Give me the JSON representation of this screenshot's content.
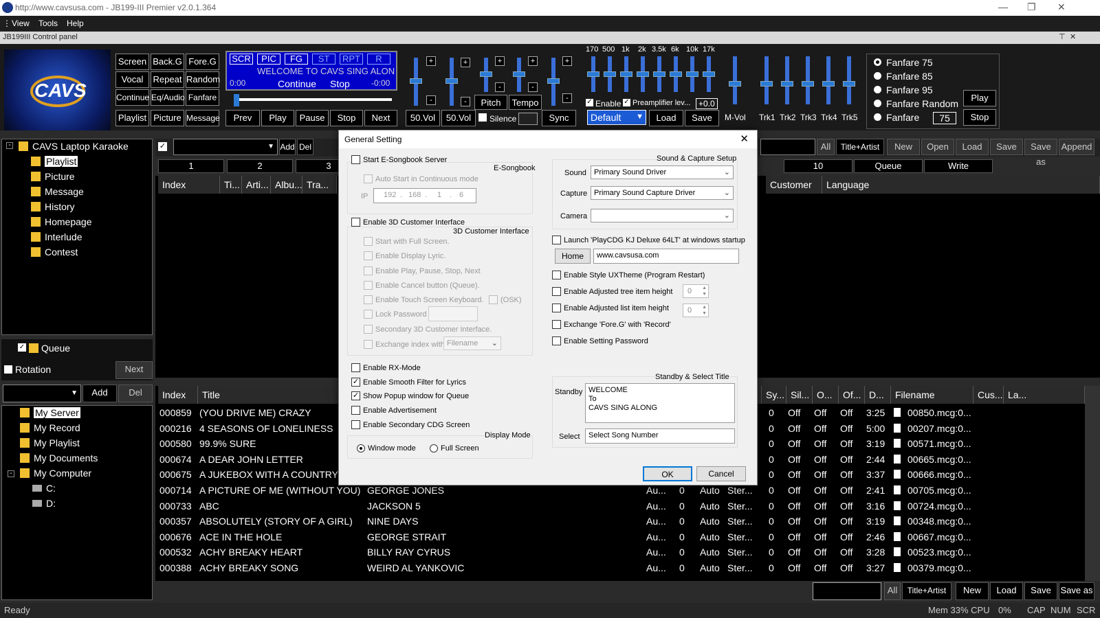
{
  "window": {
    "title": "http://www.cavsusa.com - JB199-III Premier v2.0.1.364"
  },
  "menu": [
    "View",
    "Tools",
    "Help"
  ],
  "control_panel_title": "JB199III Control panel",
  "logo_text": "CAVS",
  "control_buttons": [
    "Screen",
    "Back.G",
    "Fore.G",
    "Vocal",
    "Repeat",
    "Random",
    "Continue",
    "Eq/Audio",
    "Fanfare",
    "Playlist",
    "Picture",
    "Message"
  ],
  "screen": {
    "tags": [
      "SCR",
      "PIC",
      "FG",
      "ST",
      "RPT",
      "R"
    ],
    "marquee": "WELCOME TO CAVS SING ALON",
    "time_left": "0:00",
    "time_right": "-0:00",
    "continue": "Continue",
    "stop": "Stop"
  },
  "transport": [
    "Prev",
    "Play",
    "Pause",
    "Stop",
    "Next"
  ],
  "vol_labels": [
    "50.Vol",
    "50.Vol"
  ],
  "pitch": "Pitch",
  "tempo": "Tempo",
  "silence": "Silence",
  "sync": "Sync",
  "eq": {
    "freqs": [
      "170",
      "500",
      "1k",
      "2k",
      "3.5k",
      "6k",
      "10k",
      "17k"
    ],
    "enable": "Enable",
    "preamp": "Preamplifier lev...",
    "preamp_value": "+0.0",
    "preset": "Default",
    "load": "Load",
    "save": "Save"
  },
  "mixer": [
    "M-Vol",
    "Trk1",
    "Trk2",
    "Trk3",
    "Trk4",
    "Trk5"
  ],
  "fanfare": {
    "options": [
      "Fanfare 75",
      "Fanfare 85",
      "Fanfare 95",
      "Fanfare Random",
      "Fanfare"
    ],
    "value": "75",
    "play": "Play",
    "stop": "Stop"
  },
  "tree_top": {
    "root": "CAVS Laptop Karaoke",
    "items": [
      "Playlist",
      "Picture",
      "Message",
      "History",
      "Homepage",
      "Interlude",
      "Contest"
    ]
  },
  "queue": {
    "label": "Queue",
    "rotation": "Rotation",
    "next": "Next",
    "add": "Add",
    "del": "Del"
  },
  "tree_bottom": [
    "My Server",
    "My Record",
    "My Playlist",
    "My Documents",
    "My Computer",
    "C:",
    "D:"
  ],
  "playlist_toolbar": {
    "add": "Add",
    "del": "Del",
    "tabs": [
      "1",
      "2",
      "3"
    ],
    "right_tabs": [
      "10",
      "Queue",
      "Write"
    ],
    "all": "All",
    "sort": "Title+Artist",
    "buttons": [
      "New",
      "Open",
      "Load",
      "Save",
      "Save as",
      "Append"
    ]
  },
  "upper_headers": [
    "Index",
    "Ti...",
    "Arti...",
    "Albu...",
    "Tra..."
  ],
  "upper_right_headers": [
    "Customer",
    "Language"
  ],
  "lower_headers": [
    "Index",
    "Title",
    "Sy...",
    "Sil...",
    "O...",
    "Of...",
    "D...",
    "Filename",
    "Cus...",
    "La..."
  ],
  "songs": [
    {
      "index": "000859",
      "title": "(YOU DRIVE ME) CRAZY",
      "artist": "",
      "c1": "",
      "c2": "",
      "c3": "",
      "c4": "",
      "sy": "0",
      "sil": "Off",
      "o": "Off",
      "of": "Off",
      "d": "3:25",
      "file": "00850.mcg:0..."
    },
    {
      "index": "000216",
      "title": "4 SEASONS OF LONELINESS",
      "artist": "",
      "c1": "",
      "c2": "",
      "c3": "",
      "c4": "",
      "sy": "0",
      "sil": "Off",
      "o": "Off",
      "of": "Off",
      "d": "5:00",
      "file": "00207.mcg:0..."
    },
    {
      "index": "000580",
      "title": "99.9% SURE",
      "artist": "",
      "c1": "",
      "c2": "",
      "c3": "",
      "c4": "",
      "sy": "0",
      "sil": "Off",
      "o": "Off",
      "of": "Off",
      "d": "3:19",
      "file": "00571.mcg:0..."
    },
    {
      "index": "000674",
      "title": "A DEAR JOHN LETTER",
      "artist": "",
      "c1": "",
      "c2": "",
      "c3": "",
      "c4": "",
      "sy": "0",
      "sil": "Off",
      "o": "Off",
      "of": "Off",
      "d": "2:44",
      "file": "00665.mcg:0..."
    },
    {
      "index": "000675",
      "title": "A JUKEBOX WITH A COUNTRY S",
      "artist": "",
      "c1": "",
      "c2": "",
      "c3": "",
      "c4": "",
      "sy": "0",
      "sil": "Off",
      "o": "Off",
      "of": "Off",
      "d": "3:37",
      "file": "00666.mcg:0..."
    },
    {
      "index": "000714",
      "title": "A PICTURE OF ME (WITHOUT YOU)",
      "artist": "GEORGE JONES",
      "c1": "Au...",
      "c2": "0",
      "c3": "Auto",
      "c4": "Ster...",
      "sy": "0",
      "sil": "Off",
      "o": "Off",
      "of": "Off",
      "d": "2:41",
      "file": "00705.mcg:0..."
    },
    {
      "index": "000733",
      "title": "ABC",
      "artist": "JACKSON 5",
      "c1": "Au...",
      "c2": "0",
      "c3": "Auto",
      "c4": "Ster...",
      "sy": "0",
      "sil": "Off",
      "o": "Off",
      "of": "Off",
      "d": "3:16",
      "file": "00724.mcg:0..."
    },
    {
      "index": "000357",
      "title": "ABSOLUTELY (STORY OF A GIRL)",
      "artist": "NINE DAYS",
      "c1": "Au...",
      "c2": "0",
      "c3": "Auto",
      "c4": "Ster...",
      "sy": "0",
      "sil": "Off",
      "o": "Off",
      "of": "Off",
      "d": "3:19",
      "file": "00348.mcg:0..."
    },
    {
      "index": "000676",
      "title": "ACE IN THE HOLE",
      "artist": "GEORGE STRAIT",
      "c1": "Au...",
      "c2": "0",
      "c3": "Auto",
      "c4": "Ster...",
      "sy": "0",
      "sil": "Off",
      "o": "Off",
      "of": "Off",
      "d": "2:46",
      "file": "00667.mcg:0..."
    },
    {
      "index": "000532",
      "title": "ACHY BREAKY HEART",
      "artist": "BILLY RAY CYRUS",
      "c1": "Au...",
      "c2": "0",
      "c3": "Auto",
      "c4": "Ster...",
      "sy": "0",
      "sil": "Off",
      "o": "Off",
      "of": "Off",
      "d": "3:28",
      "file": "00523.mcg:0..."
    },
    {
      "index": "000388",
      "title": "ACHY BREAKY SONG",
      "artist": "WEIRD AL YANKOVIC",
      "c1": "Au...",
      "c2": "0",
      "c3": "Auto",
      "c4": "Ster...",
      "sy": "0",
      "sil": "Off",
      "o": "Off",
      "of": "Off",
      "d": "3:27",
      "file": "00379.mcg:0..."
    }
  ],
  "bottom_toolbar": {
    "all": "All",
    "sort": "Title+Artist",
    "buttons": [
      "New",
      "Load",
      "Save",
      "Save as"
    ]
  },
  "status": {
    "ready": "Ready",
    "mem": "Mem 33% CPU",
    "cpu": "0%",
    "caps": "CAP",
    "num": "NUM",
    "scr": "SCR"
  },
  "dialog": {
    "title": "General Setting",
    "esongbook": {
      "group": "E-Songbook",
      "start_server": "Start E-Songbook Server",
      "auto_start": "Auto Start in Continuous mode",
      "ip_label": "IP",
      "ip": [
        "192",
        "168",
        "1",
        "6"
      ]
    },
    "customer3d": {
      "group": "3D Customer Interface",
      "enable": "Enable 3D Customer Interface",
      "options": [
        "Start with Full Screen.",
        "Enable Display Lyric.",
        "Enable Play, Pause, Stop, Next",
        "Enable Cancel button (Queue).",
        "Enable Touch Screen Keyboard.",
        "Lock Password",
        "Secondary 3D Customer Interface.",
        "Exchange index with"
      ],
      "osk": "(OSK)",
      "exchange_value": "Filename"
    },
    "display": {
      "group": "Display Mode",
      "options": [
        {
          "label": "Enable RX-Mode",
          "checked": false
        },
        {
          "label": "Enable Smooth Filter for Lyrics",
          "checked": true
        },
        {
          "label": "Show Popup window for Queue",
          "checked": true
        },
        {
          "label": "Enable Advertisement",
          "checked": false
        },
        {
          "label": "Enable Secondary CDG Screen",
          "checked": false
        }
      ],
      "window_mode": "Window mode",
      "full_screen": "Full Screen"
    },
    "sound": {
      "group": "Sound & Capture Setup",
      "sound_label": "Sound",
      "sound_value": "Primary Sound Driver",
      "capture_label": "Capture",
      "capture_value": "Primary Sound Capture Driver",
      "camera_label": "Camera",
      "camera_value": ""
    },
    "launch": "Launch 'PlayCDG KJ Deluxe 64LT' at windows startup",
    "home_button": "Home",
    "home_url": "www.cavsusa.com",
    "right_options": [
      "Enable Style UXTheme (Program Restart)",
      "Enable Adjusted tree item height",
      "Enable Adjusted list item height",
      "Exchange 'Fore.G' with 'Record'",
      "Enable Setting Password"
    ],
    "tree_height": "0",
    "list_height": "0",
    "standby": {
      "group": "Standby & Select Title",
      "standby_label": "Standby",
      "standby_lines": [
        "WELCOME",
        "To",
        "CAVS SING ALONG"
      ],
      "select_label": "Select",
      "select_value": "Select Song Number"
    },
    "ok": "OK",
    "cancel": "Cancel"
  }
}
